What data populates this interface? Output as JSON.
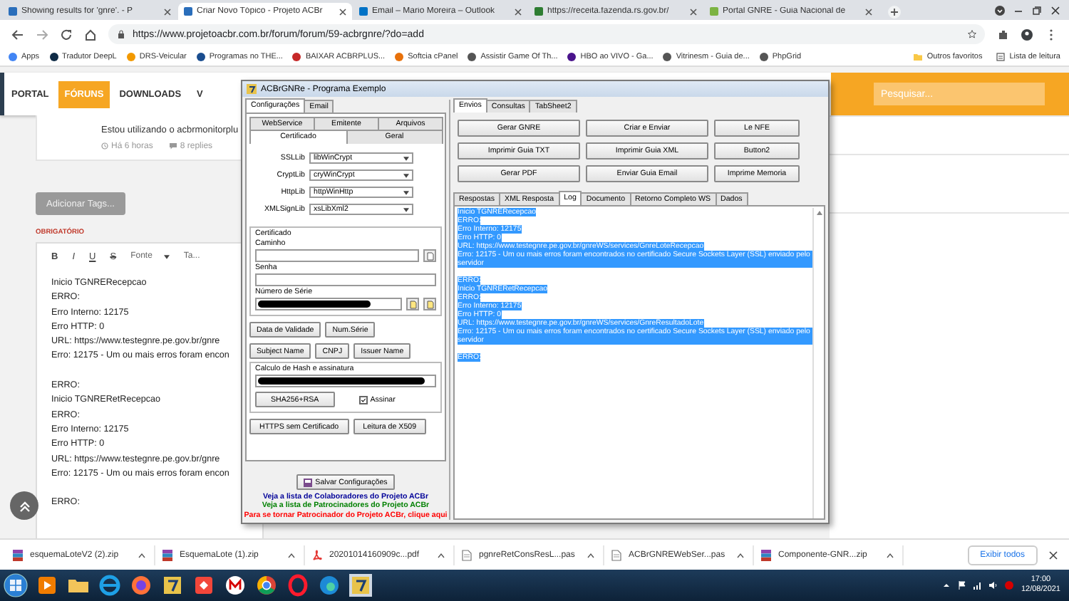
{
  "browser": {
    "tabs": [
      {
        "title": "Showing results for 'gnre'. - P",
        "selected": false
      },
      {
        "title": "Criar Novo Tópico - Projeto ACBr",
        "selected": true
      },
      {
        "title": "Email – Mario Moreira – Outlook",
        "selected": false
      },
      {
        "title": "https://receita.fazenda.rs.gov.br/",
        "selected": false
      },
      {
        "title": "Portal GNRE - Guia Nacional de",
        "selected": false
      }
    ],
    "url": "https://www.projetoacbr.com.br/forum/forum/59-acbrgnre/?do=add",
    "bookmarks": [
      "Apps",
      "Tradutor DeepL",
      "DRS-Veicular",
      "Programas no THE...",
      "BAIXAR ACBRPLUS...",
      "Softcia cPanel",
      "Assistir Game Of Th...",
      "HBO ao VIVO - Ga...",
      "Vitrinesm - Guia de...",
      "PhpGrid"
    ],
    "other_bookmarks": [
      "Outros favoritos",
      "Lista de leitura"
    ]
  },
  "forum": {
    "nav": [
      {
        "label": "PORTAL",
        "selected": false
      },
      {
        "label": "FÓRUNS",
        "selected": true
      },
      {
        "label": "DOWNLOADS",
        "selected": false
      },
      {
        "label": "V",
        "selected": false
      }
    ],
    "search": {
      "placeholder": "Pesquisar..."
    },
    "post_excerpt": "Estou utilizando o acbrmonitorplu",
    "time": "Há 6 horas",
    "replies": "8 replies",
    "tags_button": "Adicionar Tags...",
    "required_label": "OBRIGATÓRIO",
    "editor_toolbar": [
      {
        "label": "B",
        "kind": "bold"
      },
      {
        "label": "I",
        "kind": "italic"
      },
      {
        "label": "U",
        "kind": "underline"
      },
      {
        "label": "S",
        "kind": "strike"
      },
      {
        "label": "Fonte",
        "kind": "dropdown"
      },
      {
        "label": "Ta...",
        "kind": "plain"
      }
    ],
    "editor_blocks": [
      [
        "Inicio TGNRERecepcao",
        "ERRO:",
        "Erro Interno: 12175",
        "Erro HTTP: 0",
        "URL: https://www.testegnre.pe.gov.br/gnre",
        "Erro: 12175 - Um ou mais erros foram encon"
      ],
      [
        "ERRO:",
        "Inicio TGNRERetRecepcao",
        "ERRO:",
        "Erro Interno: 12175",
        "Erro HTTP: 0",
        "URL: https://www.testegnre.pe.gov.br/gnre",
        "Erro: 12175 - Um ou mais erros foram encon"
      ],
      [
        "ERRO:"
      ]
    ]
  },
  "dialog": {
    "title": "ACBrGNRe - Programa Exemplo",
    "config_tabs": [
      {
        "label": "Configurações",
        "selected": true
      },
      {
        "label": "Email",
        "selected": false
      }
    ],
    "subtabs_back": [
      {
        "label": "WebService",
        "selected": false
      },
      {
        "label": "Emitente",
        "selected": false
      },
      {
        "label": "Arquivos",
        "selected": false
      }
    ],
    "subtabs_front": [
      {
        "label": "Certificado",
        "selected": true
      },
      {
        "label": "Geral",
        "selected": false
      }
    ],
    "libs": [
      {
        "label": "SSLLib",
        "value": "libWinCrypt"
      },
      {
        "label": "CryptLib",
        "value": "cryWinCrypt"
      },
      {
        "label": "HttpLib",
        "value": "httpWinHttp"
      },
      {
        "label": "XMLSignLib",
        "value": "xsLibXml2"
      }
    ],
    "certificate": {
      "title": "Certificado",
      "path_label": "Caminho",
      "password_label": "Senha",
      "serial_label": "Número de Série"
    },
    "cert_buttons": [
      [
        "Data de Validade",
        "Num.Série"
      ],
      [
        "Subject Name",
        "CNPJ",
        "Issuer Name"
      ]
    ],
    "hash": {
      "title": "Calculo de Hash e assinatura",
      "button": "SHA256+RSA",
      "sign_label": "Assinar",
      "sign_checked": true
    },
    "bottom_buttons": [
      "HTTPS sem Certificado",
      "Leitura de X509"
    ],
    "save_button": "Salvar Configurações",
    "links": [
      {
        "text": "Veja a lista de Colaboradores do Projeto ACBr",
        "color": "#000099"
      },
      {
        "text": "Veja a lista de Patrocinadores do Projeto ACBr",
        "color": "#008000"
      },
      {
        "text": "Para se tornar Patrocinador do Projeto ACBr, clique aqui",
        "color": "#ff0000"
      }
    ],
    "action_tabs": [
      {
        "label": "Envios",
        "selected": true
      },
      {
        "label": "Consultas",
        "selected": false
      },
      {
        "label": "TabSheet2",
        "selected": false
      }
    ],
    "action_buttons": [
      "Gerar GNRE",
      "Criar e Enviar",
      "Le NFE",
      "Imprimir Guia TXT",
      "Imprimir Guia XML",
      "Button2",
      "Gerar PDF",
      "Enviar Guia Email",
      "Imprime Memoria"
    ],
    "result_tabs": [
      {
        "label": "Respostas",
        "selected": false
      },
      {
        "label": "XML Resposta",
        "selected": false
      },
      {
        "label": "Log",
        "selected": true
      },
      {
        "label": "Documento",
        "selected": false
      },
      {
        "label": "Retorno Completo WS",
        "selected": false
      },
      {
        "label": "Dados",
        "selected": false
      }
    ],
    "log_selected": true,
    "log_blocks": [
      [
        "Inicio TGNRERecepcao",
        "ERRO:",
        "Erro Interno: 12175",
        "Erro HTTP: 0",
        "URL: https://www.testegnre.pe.gov.br/gnreWS/services/GnreLoteRecepcao",
        "Erro: 12175 - Um ou mais erros foram encontrados no certificado Secure Sockets Layer (SSL) enviado pelo servidor"
      ],
      [
        "ERRO:",
        "Inicio TGNRERetRecepcao",
        "ERRO:",
        "Erro Interno: 12175",
        "Erro HTTP: 0",
        "URL: https://www.testegnre.pe.gov.br/gnreWS/services/GnreResultadoLote",
        "Erro: 12175 - Um ou mais erros foram encontrados no certificado Secure Sockets Layer (SSL) enviado pelo servidor"
      ],
      [
        "ERRO:"
      ]
    ]
  },
  "downloads": {
    "files": [
      {
        "name": "esquemaLoteV2 (2).zip",
        "kind": "archive"
      },
      {
        "name": "EsquemaLote (1).zip",
        "kind": "archive"
      },
      {
        "name": "20201014160909c...pdf",
        "kind": "pdf"
      },
      {
        "name": "pgnreRetConsResL...pas",
        "kind": "document"
      },
      {
        "name": "ACBrGNREWebSer...pas",
        "kind": "document"
      },
      {
        "name": "Componente-GNR...zip",
        "kind": "archive"
      }
    ],
    "show_all": "Exibir todos"
  },
  "taskbar": {
    "time": "17:00",
    "date": "12/08/2021"
  }
}
